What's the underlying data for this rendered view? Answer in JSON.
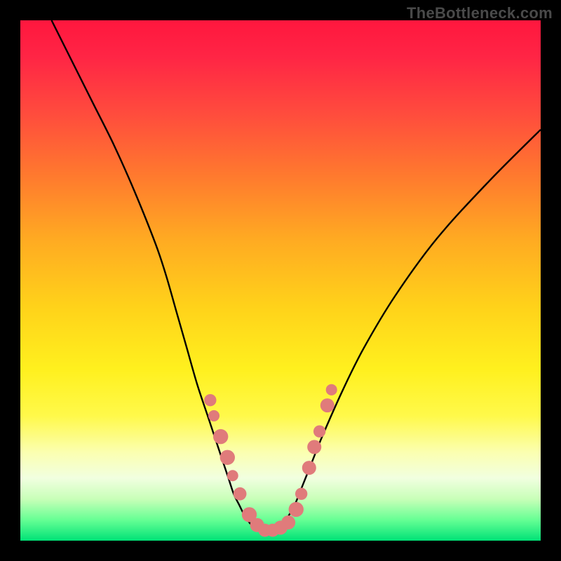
{
  "watermark": "TheBottleneck.com",
  "colors": {
    "gradient_stops": [
      {
        "offset": 0.0,
        "color": "#ff173e"
      },
      {
        "offset": 0.07,
        "color": "#ff2545"
      },
      {
        "offset": 0.18,
        "color": "#ff4c3d"
      },
      {
        "offset": 0.3,
        "color": "#ff7a2e"
      },
      {
        "offset": 0.42,
        "color": "#ffaa22"
      },
      {
        "offset": 0.55,
        "color": "#ffd21a"
      },
      {
        "offset": 0.67,
        "color": "#fff01e"
      },
      {
        "offset": 0.76,
        "color": "#fff94a"
      },
      {
        "offset": 0.83,
        "color": "#fbffb0"
      },
      {
        "offset": 0.88,
        "color": "#f1ffe0"
      },
      {
        "offset": 0.92,
        "color": "#c8ffb8"
      },
      {
        "offset": 0.96,
        "color": "#66ff94"
      },
      {
        "offset": 1.0,
        "color": "#00e277"
      }
    ],
    "curve": "#000000",
    "marker_fill": "#e07b7b",
    "marker_stroke": "#b85a5a"
  },
  "chart_data": {
    "type": "line",
    "title": "",
    "xlabel": "",
    "ylabel": "",
    "xlim": [
      0,
      100
    ],
    "ylim": [
      0,
      100
    ],
    "series": [
      {
        "name": "bottleneck-curve",
        "x": [
          6,
          10,
          14,
          18,
          22,
          26,
          28,
          30,
          32,
          34,
          36,
          38,
          40,
          41,
          42,
          43,
          44,
          45,
          46,
          47,
          48,
          49,
          50,
          51,
          52,
          53,
          54,
          56,
          58,
          62,
          66,
          72,
          80,
          90,
          100
        ],
        "y": [
          100,
          92,
          84,
          76,
          67,
          57,
          51,
          44,
          37,
          30,
          24,
          18,
          12,
          9,
          7,
          5,
          3.5,
          2.5,
          2,
          2,
          2,
          2.5,
          3,
          4,
          5.5,
          7.5,
          10,
          15,
          20,
          29,
          37,
          47,
          58,
          69,
          79
        ]
      }
    ],
    "markers": {
      "name": "highlight-points",
      "points": [
        {
          "x": 36.5,
          "y": 27,
          "r": 1.3
        },
        {
          "x": 37.2,
          "y": 24,
          "r": 1.2
        },
        {
          "x": 38.5,
          "y": 20,
          "r": 1.6
        },
        {
          "x": 39.8,
          "y": 16,
          "r": 1.6
        },
        {
          "x": 40.8,
          "y": 12.5,
          "r": 1.2
        },
        {
          "x": 42.2,
          "y": 9,
          "r": 1.4
        },
        {
          "x": 44.0,
          "y": 5,
          "r": 1.6
        },
        {
          "x": 45.5,
          "y": 3,
          "r": 1.5
        },
        {
          "x": 47.0,
          "y": 2,
          "r": 1.4
        },
        {
          "x": 48.5,
          "y": 2,
          "r": 1.4
        },
        {
          "x": 50.0,
          "y": 2.5,
          "r": 1.5
        },
        {
          "x": 51.5,
          "y": 3.5,
          "r": 1.5
        },
        {
          "x": 53.0,
          "y": 6,
          "r": 1.6
        },
        {
          "x": 54.0,
          "y": 9,
          "r": 1.3
        },
        {
          "x": 55.5,
          "y": 14,
          "r": 1.5
        },
        {
          "x": 56.5,
          "y": 18,
          "r": 1.5
        },
        {
          "x": 57.5,
          "y": 21,
          "r": 1.3
        },
        {
          "x": 59.0,
          "y": 26,
          "r": 1.5
        },
        {
          "x": 59.8,
          "y": 29,
          "r": 1.2
        }
      ]
    }
  }
}
